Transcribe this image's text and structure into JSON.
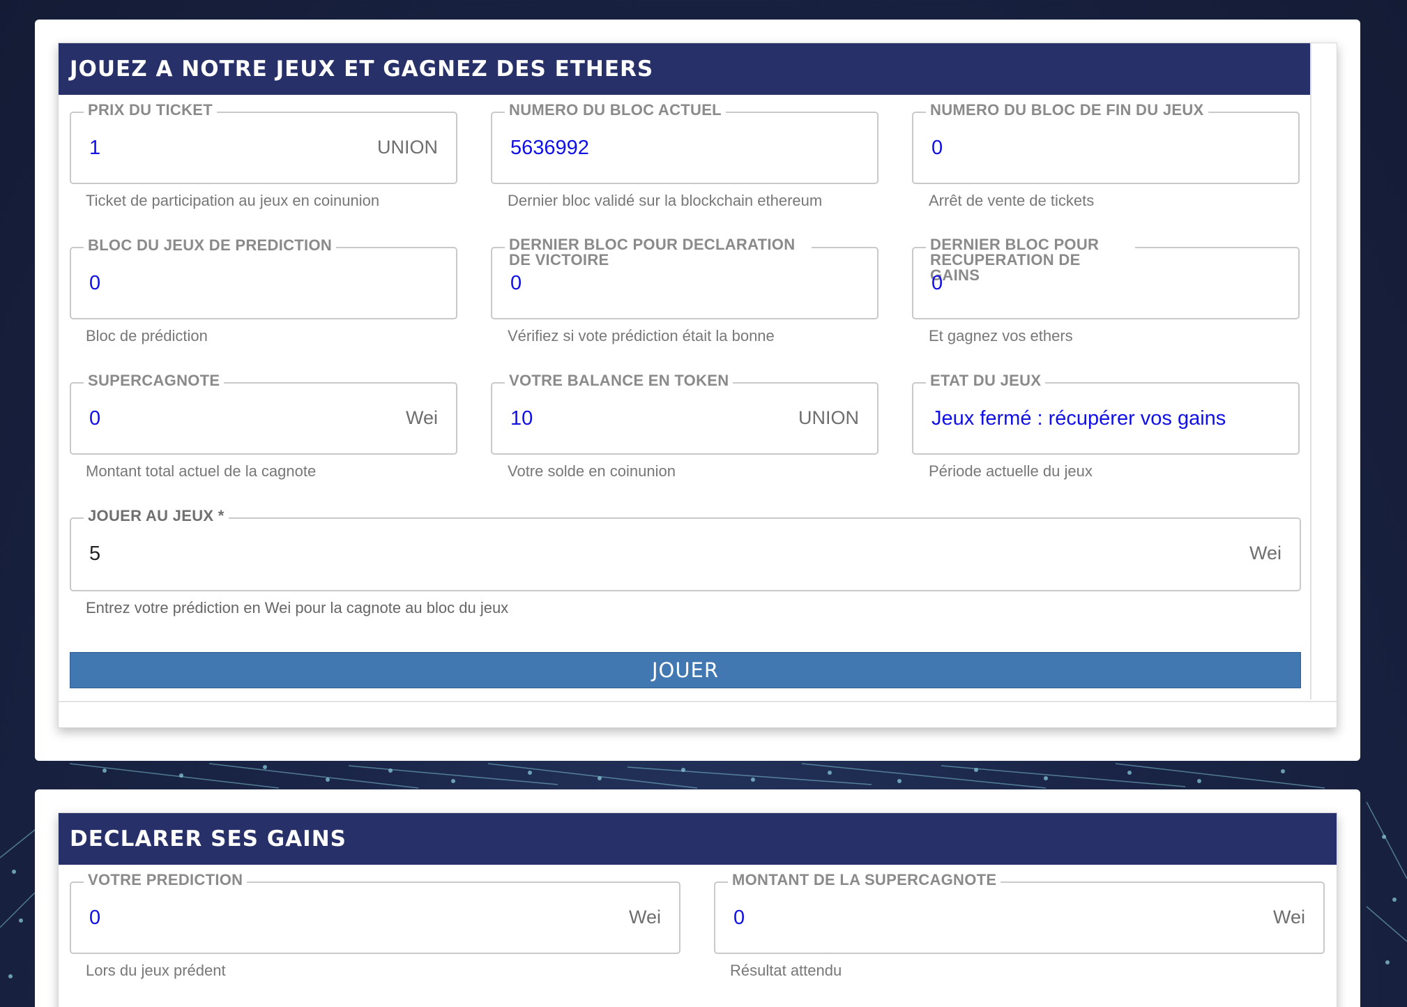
{
  "game": {
    "title": "JOUEZ A NOTRE JEUX ET GAGNEZ DES ETHERS",
    "ticket_price": {
      "label": "PRIX DU TICKET",
      "value": "1",
      "unit": "UNION",
      "hint": "Ticket de participation au jeux en coinunion"
    },
    "current_block": {
      "label": "NUMERO DU BLOC ACTUEL",
      "value": "5636992",
      "hint": "Dernier bloc validé sur la blockchain ethereum"
    },
    "end_block": {
      "label": "NUMERO DU BLOC DE FIN DU JEUX",
      "value": "0",
      "hint": "Arrêt de vente de tickets"
    },
    "prediction_block": {
      "label": "BLOC DU JEUX DE PREDICTION",
      "value": "0",
      "hint": "Bloc de prédiction"
    },
    "victory_block": {
      "label": "DERNIER BLOC POUR DECLARATION DE VICTOIRE",
      "value": "0",
      "hint": "Vérifiez si vote prédiction était la bonne"
    },
    "recovery_block": {
      "label": "DERNIER BLOC POUR RECUPERATION DE GAINS",
      "value": "0",
      "hint": "Et gagnez vos ethers"
    },
    "supercagnote": {
      "label": "SUPERCAGNOTE",
      "value": "0",
      "unit": "Wei",
      "hint": "Montant total actuel de la cagnote"
    },
    "token_balance": {
      "label": "VOTRE BALANCE EN TOKEN",
      "value": "10",
      "unit": "UNION",
      "hint": "Votre solde en coinunion"
    },
    "game_state": {
      "label": "ETAT DU JEUX",
      "value": "Jeux fermé : récupérer vos gains",
      "hint": "Période actuelle du jeux"
    },
    "play_input": {
      "label": "JOUER AU JEUX *",
      "value": "5",
      "unit": "Wei",
      "hint": "Entrez votre prédiction en Wei pour la cagnote au bloc du jeux"
    },
    "play_button": "JOUER"
  },
  "declare": {
    "title": "DECLARER SES GAINS",
    "prediction": {
      "label": "VOTRE PREDICTION",
      "value": "0",
      "unit": "Wei",
      "hint": "Lors du jeux prédent"
    },
    "supercagnote_amount": {
      "label": "MONTANT DE LA SUPERCAGNOTE",
      "value": "0",
      "unit": "Wei",
      "hint": "Résultat attendu"
    }
  },
  "colors": {
    "header": "#273068",
    "button": "#4178b2",
    "value": "#1010e6"
  }
}
